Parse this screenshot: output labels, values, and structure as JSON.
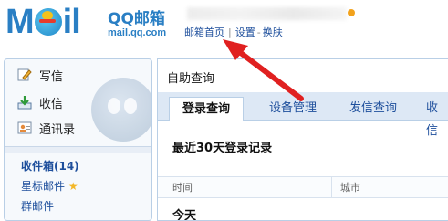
{
  "brand": {
    "logo_left": "M",
    "logo_right": "il",
    "name": "QQ邮箱",
    "url": "mail.qq.com"
  },
  "topnav": {
    "home": "邮箱首页",
    "settings": "设置",
    "skin": "换肤"
  },
  "sidebar": {
    "write": "写信",
    "receive": "收信",
    "contacts": "通讯录",
    "folders": [
      {
        "label": "收件箱(14)"
      },
      {
        "label": "星标邮件"
      },
      {
        "label": "群邮件"
      }
    ]
  },
  "main": {
    "title": "自助查询",
    "tabs": [
      {
        "label": "登录查询"
      },
      {
        "label": "设备管理"
      },
      {
        "label": "发信查询"
      },
      {
        "label": "收信"
      }
    ],
    "section_title": "最近30天登录记录",
    "columns": [
      "时间",
      "城市"
    ],
    "group_label": "今天"
  },
  "colors": {
    "brand_blue": "#2a7fc4",
    "link_blue": "#1e4f9c",
    "arrow_red": "#e02020",
    "tab_bg": "#dde8f5"
  }
}
